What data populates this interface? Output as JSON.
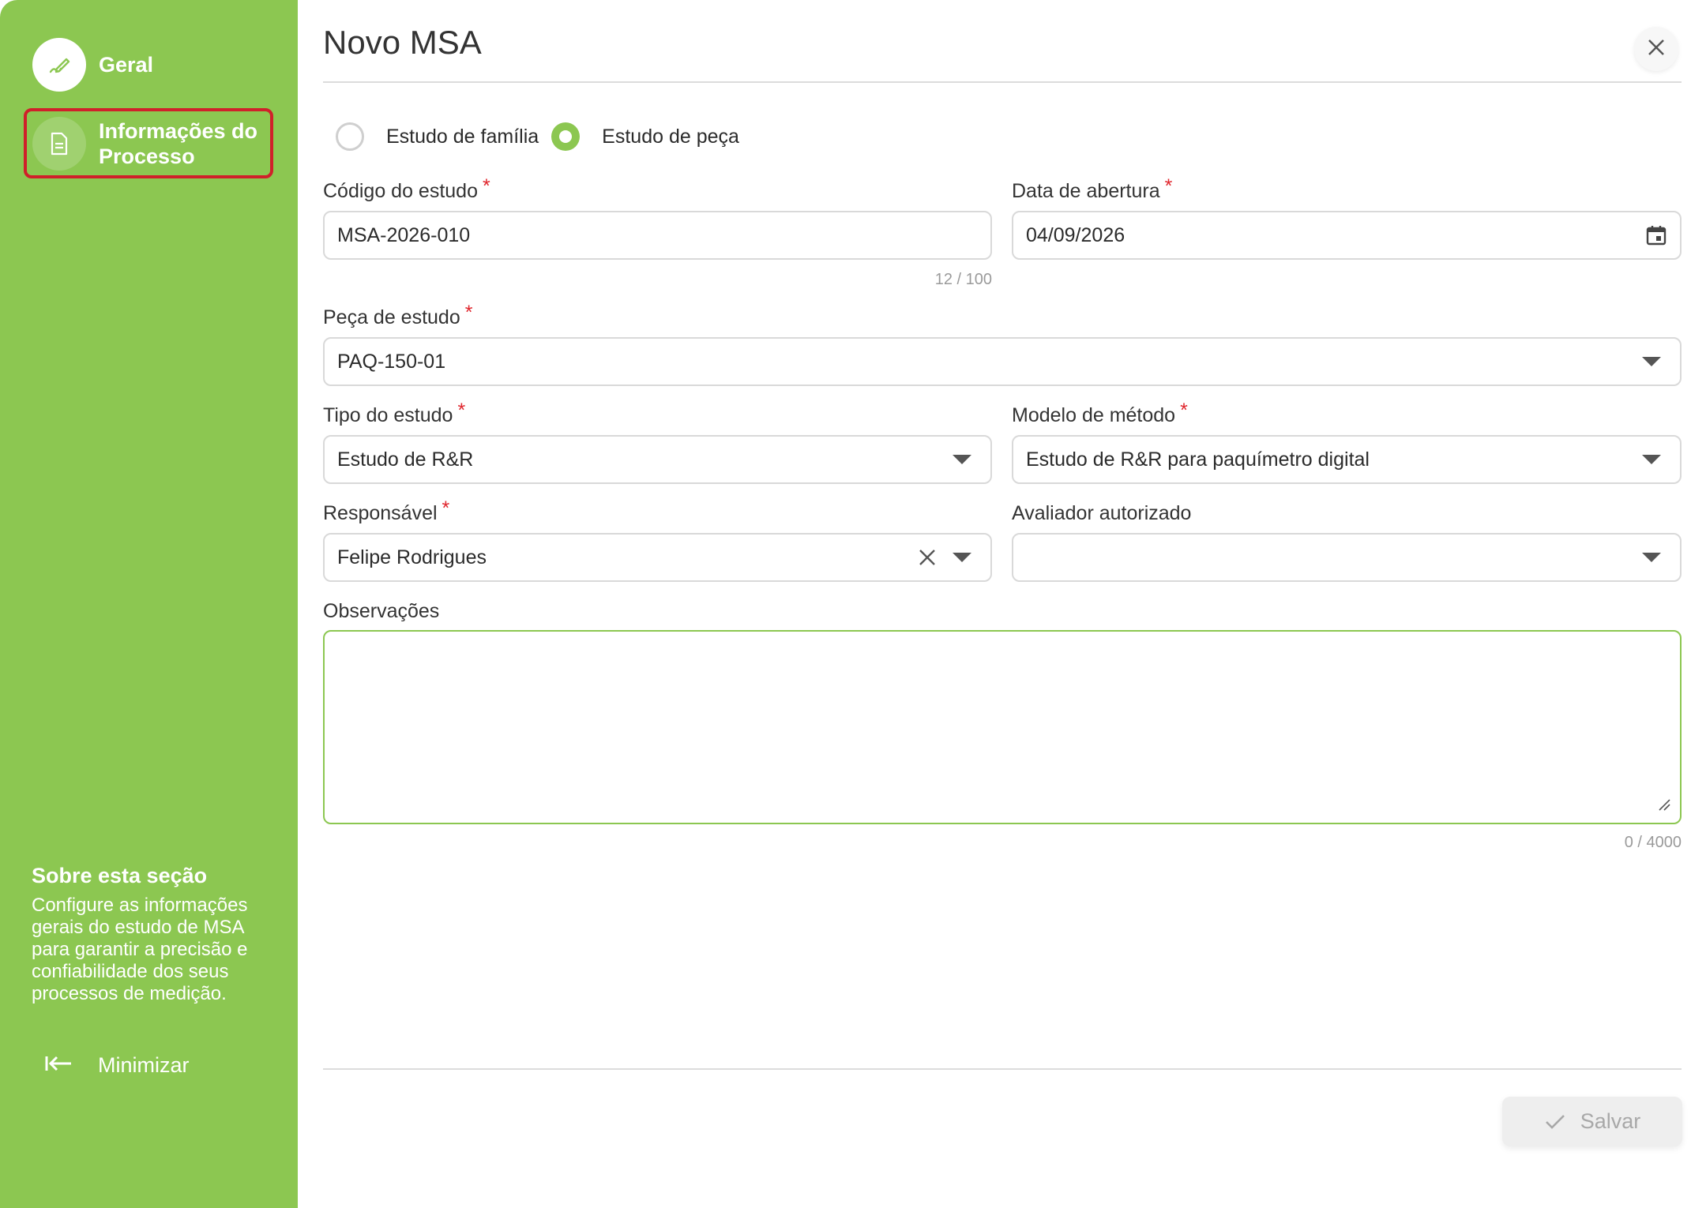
{
  "sidebar": {
    "steps": [
      {
        "label": "Geral",
        "icon": "pencil-wave-icon"
      },
      {
        "label": "Informações do Processo",
        "icon": "document-icon"
      }
    ],
    "about_title": "Sobre esta seção",
    "about_text": "Configure as informações gerais do estudo de MSA para garantir a precisão e confiabilidade dos seus processos de medição.",
    "minimize_label": "Minimizar",
    "accent_color": "#8cc751",
    "highlight_color": "#d0202a"
  },
  "dialog": {
    "title": "Novo MSA",
    "radio_options": [
      {
        "label": "Estudo de família",
        "checked": false
      },
      {
        "label": "Estudo de peça",
        "checked": true
      }
    ],
    "fields": {
      "codigo": {
        "label": "Código do estudo",
        "value": "MSA-2026-010",
        "counter": "12 / 100"
      },
      "data": {
        "label": "Data de abertura",
        "value": "04/09/2026"
      },
      "peca": {
        "label": "Peça de estudo",
        "value": "PAQ-150-01"
      },
      "tipo": {
        "label": "Tipo do estudo",
        "value": "Estudo de R&R"
      },
      "modelo": {
        "label": "Modelo de método",
        "value": "Estudo de R&R para paquímetro digital"
      },
      "responsavel": {
        "label": "Responsável",
        "value": "Felipe Rodrigues"
      },
      "avaliador": {
        "label": "Avaliador autorizado",
        "value": ""
      },
      "observacoes": {
        "label": "Observações",
        "value": "",
        "counter": "0 / 4000"
      }
    },
    "required_marker": "*",
    "save_label": "Salvar"
  }
}
